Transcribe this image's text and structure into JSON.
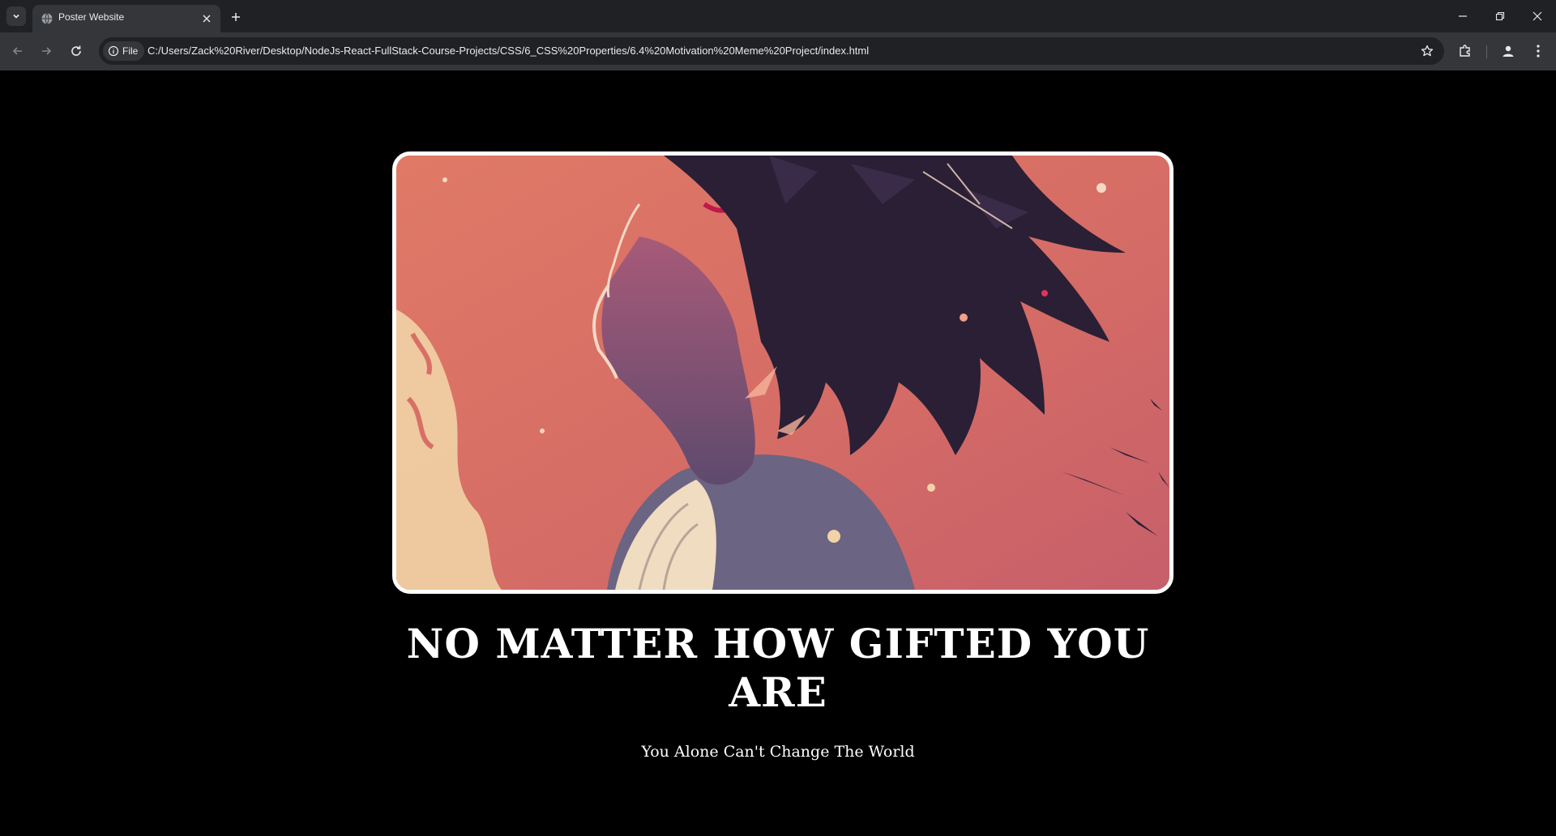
{
  "browser": {
    "tab": {
      "title": "Poster Website"
    },
    "address_bar": {
      "scheme_chip": "File",
      "url": "C:/Users/Zack%20River/Desktop/NodeJs-React-FullStack-Course-Projects/CSS/6_CSS%20Properties/6.4%20Motivation%20Meme%20Project/index.html"
    },
    "icons": {
      "tab_search": "chevron-down-icon",
      "favicon": "globe-icon",
      "tab_close": "close-icon",
      "new_tab": "plus-icon",
      "minimize": "minimize-icon",
      "restore": "restore-icon",
      "close_window": "close-icon",
      "back": "arrow-left-icon",
      "forward": "arrow-right-icon",
      "reload": "reload-icon",
      "site_info": "info-icon",
      "bookmark": "star-icon",
      "extensions": "puzzle-icon",
      "profile": "person-icon",
      "menu": "kebab-menu-icon"
    }
  },
  "poster": {
    "image_alt": "anime character looking upward",
    "headline": "NO MATTER HOW GIFTED YOU ARE",
    "subline": "You Alone Can't Change The World"
  },
  "colors": {
    "page_background": "#000000",
    "frame_border": "#ffffff",
    "poster_background": "#d86f66",
    "text": "#ffffff"
  }
}
